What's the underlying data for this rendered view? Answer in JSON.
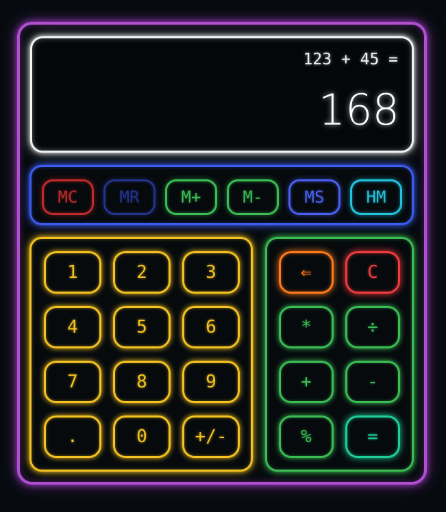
{
  "display": {
    "expression": "123 + 45 =",
    "result": "168"
  },
  "memory_buttons": [
    {
      "label": "MC",
      "color": "#c02a2a",
      "glow": "rgba(192,42,42,0.55)"
    },
    {
      "label": "MR",
      "color": "#24338c",
      "glow": "rgba(36,51,140,0.55)"
    },
    {
      "label": "M+",
      "color": "#3cbd54",
      "glow": "rgba(60,189,84,0.55)"
    },
    {
      "label": "M-",
      "color": "#3cbd54",
      "glow": "rgba(60,189,84,0.55)"
    },
    {
      "label": "MS",
      "color": "#4a5ff0",
      "glow": "rgba(74,95,240,0.6)"
    },
    {
      "label": "HM",
      "color": "#22c3dd",
      "glow": "rgba(34,195,221,0.6)"
    }
  ],
  "number_keys": [
    "1",
    "2",
    "3",
    "4",
    "5",
    "6",
    "7",
    "8",
    "9",
    ".",
    "0",
    "+/-"
  ],
  "operator_keys": [
    {
      "label": "⇐",
      "style": "orange"
    },
    {
      "label": "C",
      "style": "red"
    },
    {
      "label": "*",
      "style": "green"
    },
    {
      "label": "÷",
      "style": "green"
    },
    {
      "label": "+",
      "style": "green"
    },
    {
      "label": "-",
      "style": "green"
    },
    {
      "label": "%",
      "style": "green"
    },
    {
      "label": "=",
      "style": "teal"
    }
  ],
  "colors": {
    "frame": "#b14fd0",
    "display_border": "#f2f2f2",
    "memory_panel": "#3d5cf0",
    "number_panel": "#f4c221",
    "operator_panel": "#3cbd54",
    "background": "#070b0f"
  }
}
